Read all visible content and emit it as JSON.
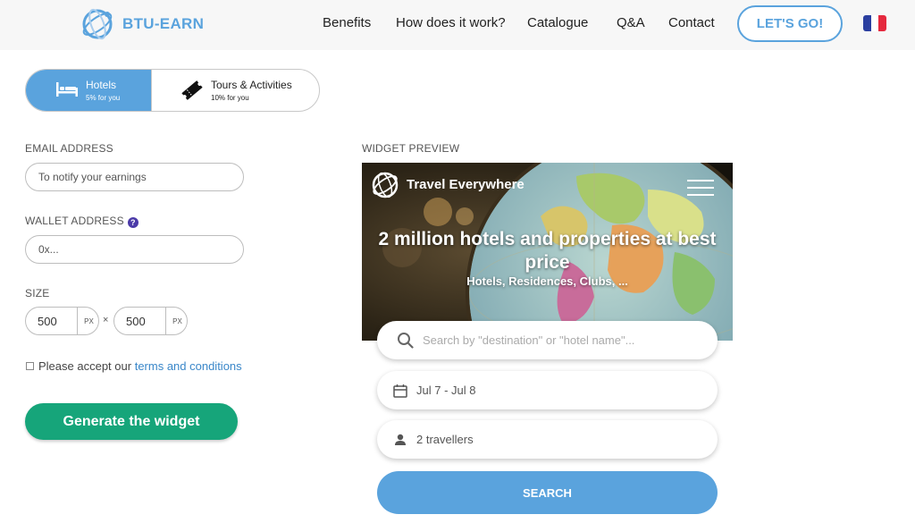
{
  "header": {
    "logo_text": "BTU-EARN",
    "nav": [
      "Benefits",
      "How does it work?",
      "Catalogue",
      "Q&A",
      "Contact"
    ],
    "cta_label": "LET'S GO!",
    "flag_colors": [
      "#2b3fa0",
      "#ffffff",
      "#e5293e"
    ]
  },
  "toggle": {
    "hotels": {
      "label": "Hotels",
      "sub": "5% for you"
    },
    "tours": {
      "label": "Tours & Activities",
      "sub": "10% for you"
    }
  },
  "form": {
    "email_label": "EMAIL ADDRESS",
    "email_placeholder": "To notify your earnings",
    "wallet_label": "WALLET ADDRESS",
    "wallet_help": "?",
    "wallet_placeholder": "0x...",
    "size_label": "SIZE",
    "width_value": "500",
    "height_value": "500",
    "unit": "PX",
    "times": "×",
    "terms_prefix": "Please accept our",
    "terms_link": "terms and conditions",
    "generate_label": "Generate the widget"
  },
  "widget": {
    "preview_label": "WIDGET PREVIEW",
    "brand": "Travel Everywhere",
    "headline": "2 million hotels and properties at best price",
    "subline": "Hotels, Residences, Clubs, ...",
    "search_placeholder": "Search by \"destination\" or \"hotel name\"...",
    "dates": "Jul 7 - Jul 8",
    "travellers": "2 travellers",
    "search_button": "SEARCH"
  },
  "colors": {
    "brand_blue": "#5aa3dd",
    "generate_green": "#16a57a",
    "link_blue": "#3a87c9"
  }
}
